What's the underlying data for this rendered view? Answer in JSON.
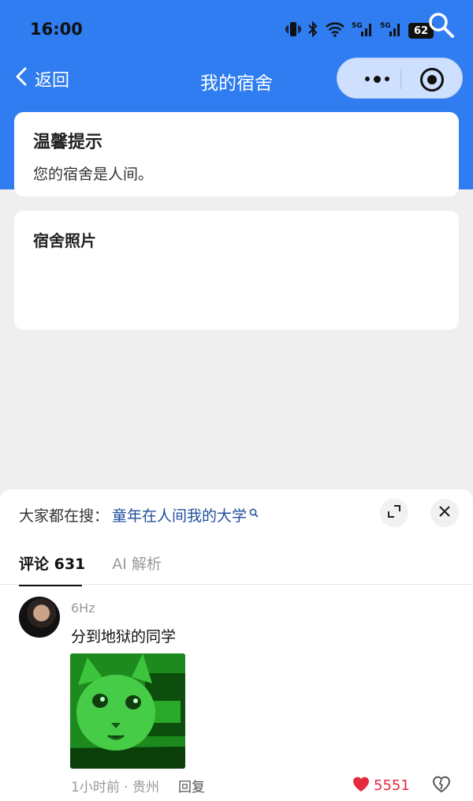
{
  "status_bar": {
    "time": "16:00",
    "network_a": "5G",
    "network_b": "5G",
    "battery": "62",
    "icons": [
      "vibrate-icon",
      "bluetooth-icon",
      "wifi-icon",
      "signal-icon",
      "signal-icon",
      "battery-icon"
    ]
  },
  "nav": {
    "back_label": "返回",
    "title": "我的宿舍"
  },
  "tip_card": {
    "title": "温馨提示",
    "text": "您的宿舍是人间。"
  },
  "photo_card": {
    "title": "宿舍照片"
  },
  "sheet": {
    "hot_search_label": "大家都在搜：",
    "hot_search_term": "童年在人间我的大学",
    "tabs": [
      {
        "label": "评论 631",
        "active": true
      },
      {
        "label": "AI 解析",
        "active": false
      }
    ],
    "comment": {
      "user": "6Hz",
      "text": "分到地狱的同学",
      "time": "1小时前 · 贵州",
      "reply_label": "回复",
      "likes": "5551"
    }
  },
  "colors": {
    "brand_blue": "#2f7df1",
    "capsule_bg": "#cfe0ff",
    "link_blue": "#1f4e9c",
    "like_red": "#e5293e",
    "image_green": "#1e8f1e"
  }
}
